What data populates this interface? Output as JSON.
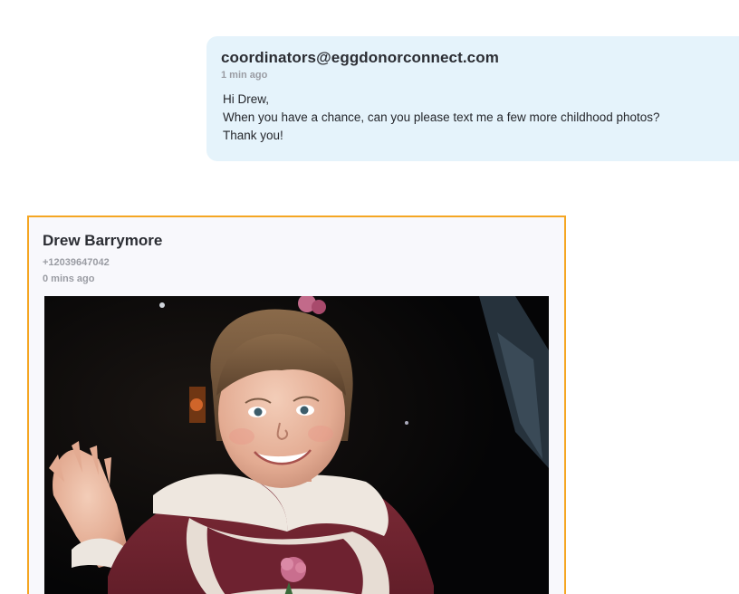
{
  "outgoing_message": {
    "sender": "coordinators@eggdonorconnect.com",
    "time": "1 min ago",
    "lines": [
      "Hi Drew,",
      "When you have a chance, can you please text me a few more childhood photos?",
      "Thank you!"
    ],
    "bubble_color": "#e5f3fb"
  },
  "incoming_message": {
    "name": "Drew Barrymore",
    "phone": "+12039647042",
    "time": "0 mins ago",
    "border_color": "#f5a623",
    "attachment": {
      "type": "image",
      "subject": "childhood-photo"
    }
  }
}
